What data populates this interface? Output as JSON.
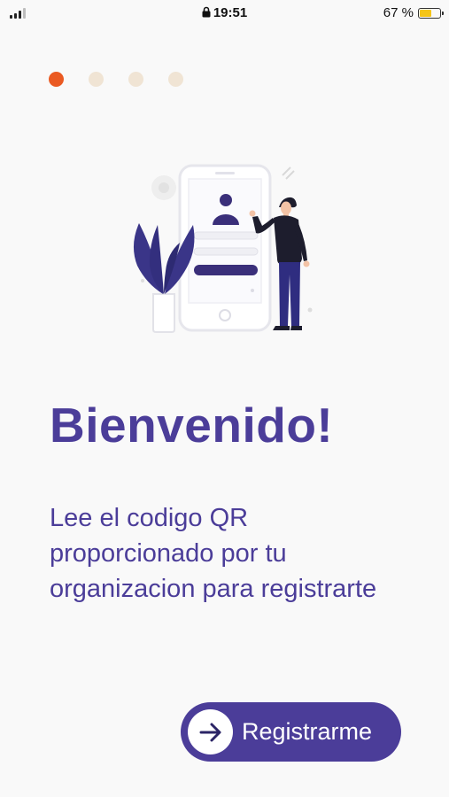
{
  "status_bar": {
    "time": "19:51",
    "battery_percent": "67 %",
    "battery_level": 0.67,
    "battery_color": "#f5c518"
  },
  "onboarding": {
    "total_pages": 4,
    "active_page": 1,
    "active_color": "#ea5a22",
    "inactive_color": "#f0e4d4"
  },
  "illustration": {
    "icon": "person-with-phone-illustration"
  },
  "content": {
    "title": "Bienvenido!",
    "subtitle": "Lee el codigo QR proporcionado por tu organizacion para registrarte"
  },
  "actions": {
    "register_label": "Registrarme",
    "register_icon": "arrow-right-icon"
  },
  "colors": {
    "brand": "#4b3d99",
    "background": "#f9f9f9"
  }
}
